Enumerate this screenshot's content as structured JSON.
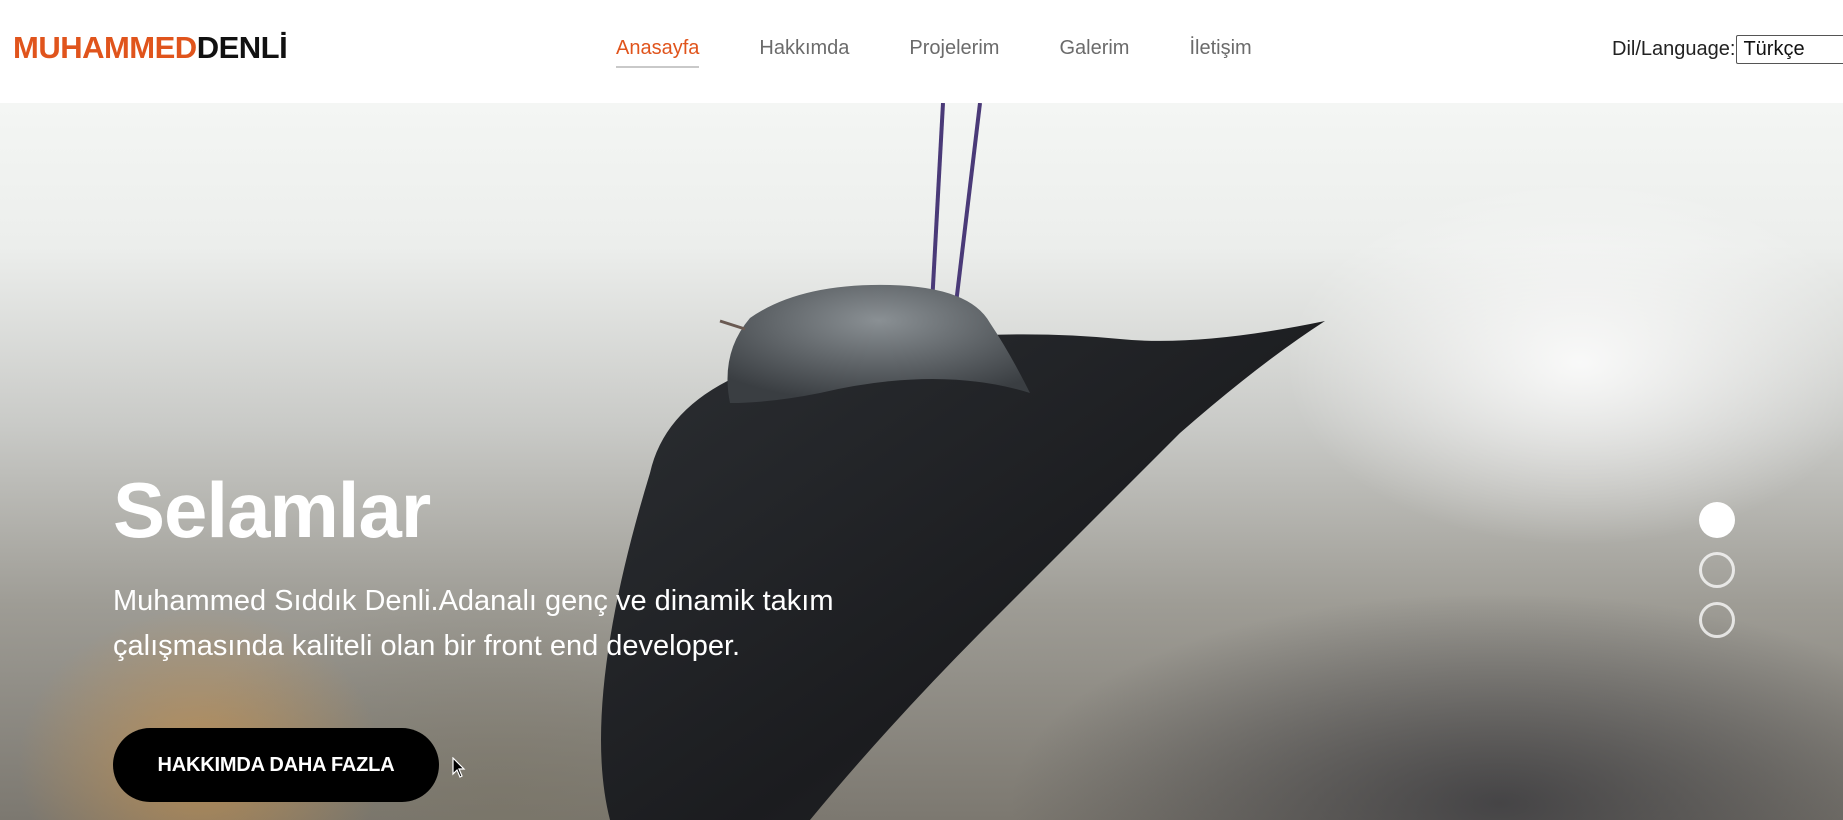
{
  "header": {
    "logo_first": "MUHAMMED",
    "logo_last": "DENLİ",
    "nav": [
      {
        "label": "Anasayfa",
        "active": true
      },
      {
        "label": "Hakkımda",
        "active": false
      },
      {
        "label": "Projelerim",
        "active": false
      },
      {
        "label": "Galerim",
        "active": false
      },
      {
        "label": "İletişim",
        "active": false
      }
    ],
    "language": {
      "label": "Dil/Language:",
      "selected": "Türkçe"
    }
  },
  "hero": {
    "title": "Selamlar",
    "description": "Muhammed Sıddık Denli.Adanalı genç ve dinamik takım çalışmasında kaliteli olan bir front end developer.",
    "button_label": "HAKKIMDA DAHA FAZLA",
    "slides": {
      "count": 3,
      "active_index": 0
    }
  },
  "colors": {
    "accent": "#e0541c",
    "nav_text": "#6b6b6b",
    "button_bg": "#000000"
  },
  "icons": {
    "language_chevron": "chevron-down-icon",
    "cursor": "mouse-pointer-icon"
  }
}
